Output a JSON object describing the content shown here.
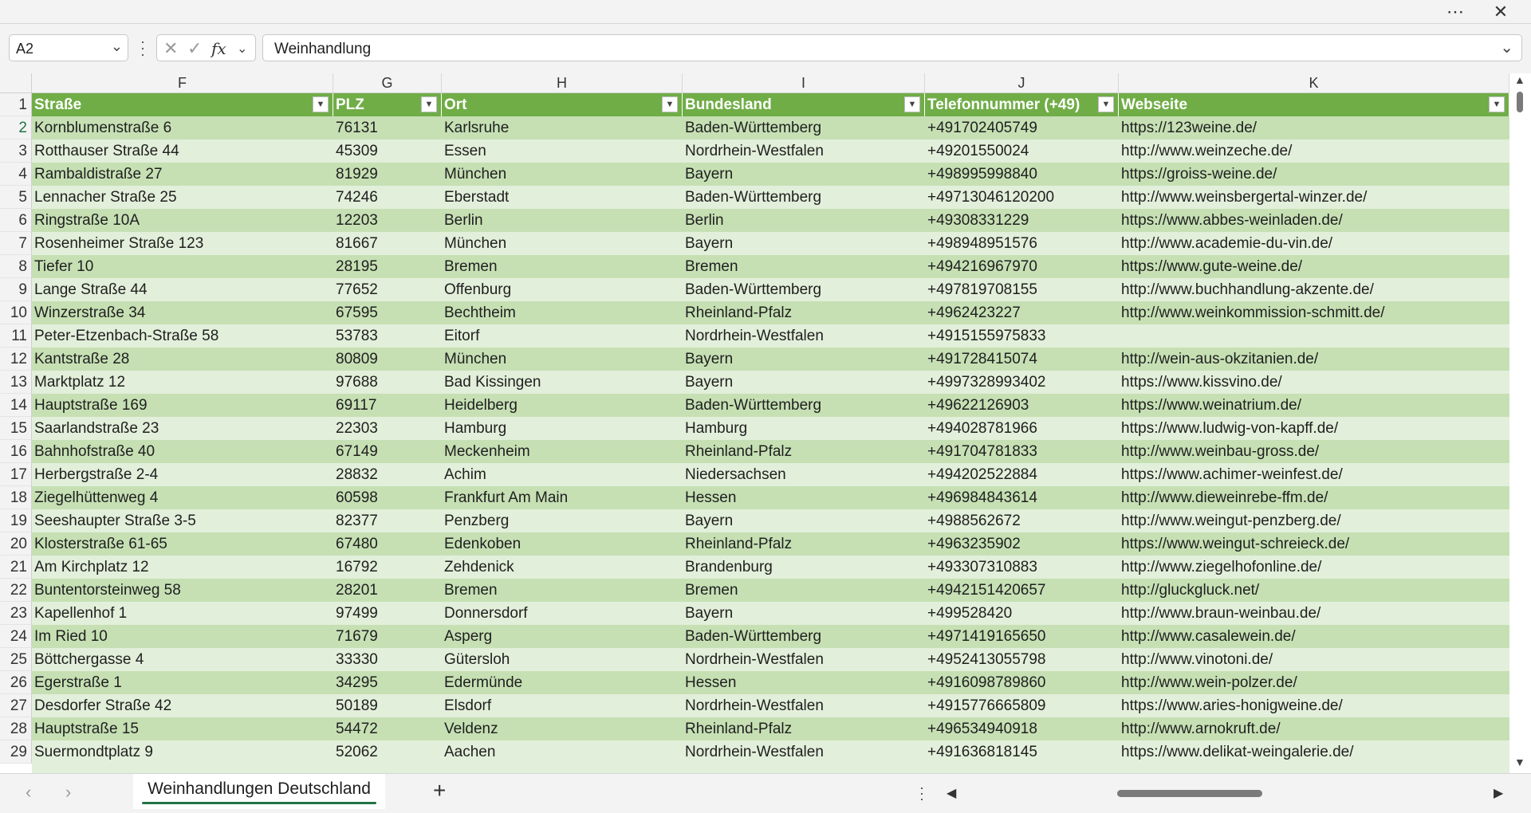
{
  "titlebar": {
    "more_icon": "more-horizontal-icon",
    "close_icon": "close-icon"
  },
  "formula_bar": {
    "name_box": "A2",
    "formula_value": "Weinhandlung",
    "fx_label": "fx"
  },
  "columns": [
    "F",
    "G",
    "H",
    "I",
    "J",
    "K"
  ],
  "table_headers": [
    "Straße",
    "PLZ",
    "Ort",
    "Bundesland",
    "Telefonnummer (+49)",
    "Webseite"
  ],
  "rows": [
    {
      "n": "2",
      "cells": [
        "Kornblumenstraße 6",
        "76131",
        "Karlsruhe",
        "Baden-Württemberg",
        "+491702405749",
        "https://123weine.de/"
      ]
    },
    {
      "n": "3",
      "cells": [
        "Rotthauser Straße 44",
        "45309",
        "Essen",
        "Nordrhein-Westfalen",
        "+49201550024",
        "http://www.weinzeche.de/"
      ]
    },
    {
      "n": "4",
      "cells": [
        "Rambaldistraße 27",
        "81929",
        "München",
        "Bayern",
        "+498995998840",
        "https://groiss-weine.de/"
      ]
    },
    {
      "n": "5",
      "cells": [
        "Lennacher Straße 25",
        "74246",
        "Eberstadt",
        "Baden-Württemberg",
        "+49713046120200",
        "http://www.weinsbergertal-winzer.de/"
      ]
    },
    {
      "n": "6",
      "cells": [
        "Ringstraße 10A",
        "12203",
        "Berlin",
        "Berlin",
        "+49308331229",
        "https://www.abbes-weinladen.de/"
      ]
    },
    {
      "n": "7",
      "cells": [
        "Rosenheimer Straße 123",
        "81667",
        "München",
        "Bayern",
        "+498948951576",
        "http://www.academie-du-vin.de/"
      ]
    },
    {
      "n": "8",
      "cells": [
        "Tiefer 10",
        "28195",
        "Bremen",
        "Bremen",
        "+494216967970",
        "https://www.gute-weine.de/"
      ]
    },
    {
      "n": "9",
      "cells": [
        "Lange Straße 44",
        "77652",
        "Offenburg",
        "Baden-Württemberg",
        "+497819708155",
        "http://www.buchhandlung-akzente.de/"
      ]
    },
    {
      "n": "10",
      "cells": [
        "Winzerstraße 34",
        "67595",
        "Bechtheim",
        "Rheinland-Pfalz",
        "+4962423227",
        "http://www.weinkommission-schmitt.de/"
      ]
    },
    {
      "n": "11",
      "cells": [
        "Peter-Etzenbach-Straße 58",
        "53783",
        "Eitorf",
        "Nordrhein-Westfalen",
        "+4915155975833",
        ""
      ]
    },
    {
      "n": "12",
      "cells": [
        "Kantstraße 28",
        "80809",
        "München",
        "Bayern",
        "+491728415074",
        "http://wein-aus-okzitanien.de/"
      ]
    },
    {
      "n": "13",
      "cells": [
        "Marktplatz 12",
        "97688",
        "Bad Kissingen",
        "Bayern",
        "+4997328993402",
        "https://www.kissvino.de/"
      ]
    },
    {
      "n": "14",
      "cells": [
        "Hauptstraße 169",
        "69117",
        "Heidelberg",
        "Baden-Württemberg",
        "+49622126903",
        "https://www.weinatrium.de/"
      ]
    },
    {
      "n": "15",
      "cells": [
        "Saarlandstraße 23",
        "22303",
        "Hamburg",
        "Hamburg",
        "+494028781966",
        "https://www.ludwig-von-kapff.de/"
      ]
    },
    {
      "n": "16",
      "cells": [
        "Bahnhofstraße 40",
        "67149",
        "Meckenheim",
        "Rheinland-Pfalz",
        "+491704781833",
        "http://www.weinbau-gross.de/"
      ]
    },
    {
      "n": "17",
      "cells": [
        "Herbergstraße 2-4",
        "28832",
        "Achim",
        "Niedersachsen",
        "+494202522884",
        "https://www.achimer-weinfest.de/"
      ]
    },
    {
      "n": "18",
      "cells": [
        "Ziegelhüttenweg 4",
        "60598",
        "Frankfurt Am Main",
        "Hessen",
        "+496984843614",
        "http://www.dieweinrebe-ffm.de/"
      ]
    },
    {
      "n": "19",
      "cells": [
        "Seeshaupter Straße 3-5",
        "82377",
        "Penzberg",
        "Bayern",
        "+4988562672",
        "http://www.weingut-penzberg.de/"
      ]
    },
    {
      "n": "20",
      "cells": [
        "Klosterstraße 61-65",
        "67480",
        "Edenkoben",
        "Rheinland-Pfalz",
        "+4963235902",
        "https://www.weingut-schreieck.de/"
      ]
    },
    {
      "n": "21",
      "cells": [
        "Am Kirchplatz 12",
        "16792",
        "Zehdenick",
        "Brandenburg",
        "+493307310883",
        "http://www.ziegelhofonline.de/"
      ]
    },
    {
      "n": "22",
      "cells": [
        "Buntentorsteinweg 58",
        "28201",
        "Bremen",
        "Bremen",
        "+4942151420657",
        "http://gluckgluck.net/"
      ]
    },
    {
      "n": "23",
      "cells": [
        "Kapellenhof 1",
        "97499",
        "Donnersdorf",
        "Bayern",
        "+499528420",
        "http://www.braun-weinbau.de/"
      ]
    },
    {
      "n": "24",
      "cells": [
        "Im Ried 10",
        "71679",
        "Asperg",
        "Baden-Württemberg",
        "+4971419165650",
        "http://www.casalewein.de/"
      ]
    },
    {
      "n": "25",
      "cells": [
        "Böttchergasse 4",
        "33330",
        "Gütersloh",
        "Nordrhein-Westfalen",
        "+4952413055798",
        "http://www.vinotoni.de/"
      ]
    },
    {
      "n": "26",
      "cells": [
        "Egerstraße 1",
        "34295",
        "Edermünde",
        "Hessen",
        "+4916098789860",
        "http://www.wein-polzer.de/"
      ]
    },
    {
      "n": "27",
      "cells": [
        "Desdorfer Straße 42",
        "50189",
        "Elsdorf",
        "Nordrhein-Westfalen",
        "+4915776665809",
        "https://www.aries-honigweine.de/"
      ]
    },
    {
      "n": "28",
      "cells": [
        "Hauptstraße 15",
        "54472",
        "Veldenz",
        "Rheinland-Pfalz",
        "+496534940918",
        "http://www.arnokruft.de/"
      ]
    },
    {
      "n": "29",
      "cells": [
        "Suermondtplatz 9",
        "52062",
        "Aachen",
        "Nordrhein-Westfalen",
        "+491636818145",
        "https://www.delikat-weingalerie.de/"
      ]
    }
  ],
  "sheet_tabs": [
    {
      "label": "Weinhandlungen Deutschland",
      "active": true
    }
  ],
  "colors": {
    "header_green": "#70ad47",
    "band_dark": "#c6e0b4",
    "band_light": "#e2efda",
    "accent": "#217346"
  }
}
